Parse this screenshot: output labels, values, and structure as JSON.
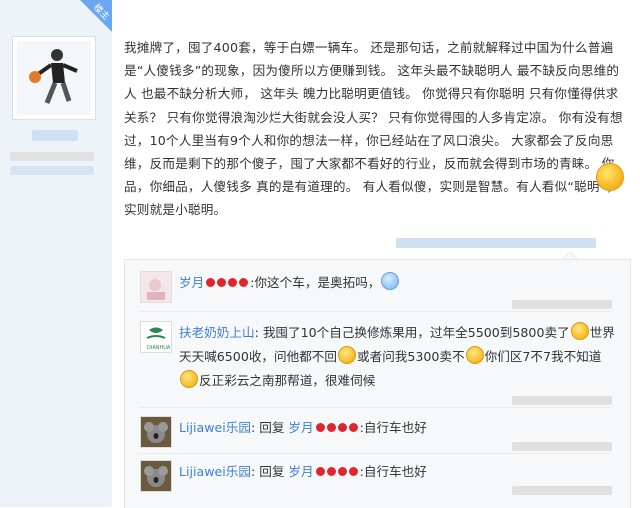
{
  "op_badge": "楼主",
  "post": {
    "text": "我摊牌了，囤了400套，等于白嫖一辆车。 还是那句话，之前就解释过中国为什么普遍是“人傻钱多”的现象，因为傻所以方便赚到钱。 这年头最不缺聪明人 最不缺反向思维的人 也最不缺分析大师， 这年头 魄力比聪明更值钱。 你觉得只有你聪明 只有你懂得供求关系？ 只有你觉得浪淘沙烂大街就会没人买？ 只有你觉得囤的人多肯定凉。 你有没有想过，10个人里当有9个人和你的想法一样，你已经站在了风口浪尖。 大家都会了反向思维，反而是剩下的那个傻子，囤了大家都不看好的行业，反而就会得到市场的青睐。 你品，你细品，人傻钱多 真的是有道理的。 有人看似傻，实则是智慧。有人看似“聪明”，实则就是小聪明。"
  },
  "replies": [
    {
      "user": "岁月",
      "cherries": 4,
      "sep": ":",
      "content_a": "你这个车，是奥拓吗，",
      "emoji": "sweat-smile-emoji"
    },
    {
      "user": "扶老奶奶上山",
      "sep": ":",
      "segments": [
        "我囤了10个自己换修炼果用，过年全5500到5800卖了",
        "世界天天喊6500收，问他都不回",
        "或者问我5300卖不",
        "你们区7不7我不知道",
        "反正彩云之南那帮道，很难伺候"
      ]
    },
    {
      "user": "Lijiawei乐园",
      "reply_word": "回复",
      "target": "岁月",
      "cherries": 4,
      "content": ":自行车也好"
    },
    {
      "user": "Lijiawei乐园",
      "reply_word": "回复",
      "target": "岁月",
      "cherries": 4,
      "content": ":自行车也好"
    }
  ],
  "colors": {
    "link": "#3e7fd6",
    "left_bg": "#eef3fa",
    "badge": "#6aa6f2",
    "cherry": "#e0252e"
  }
}
